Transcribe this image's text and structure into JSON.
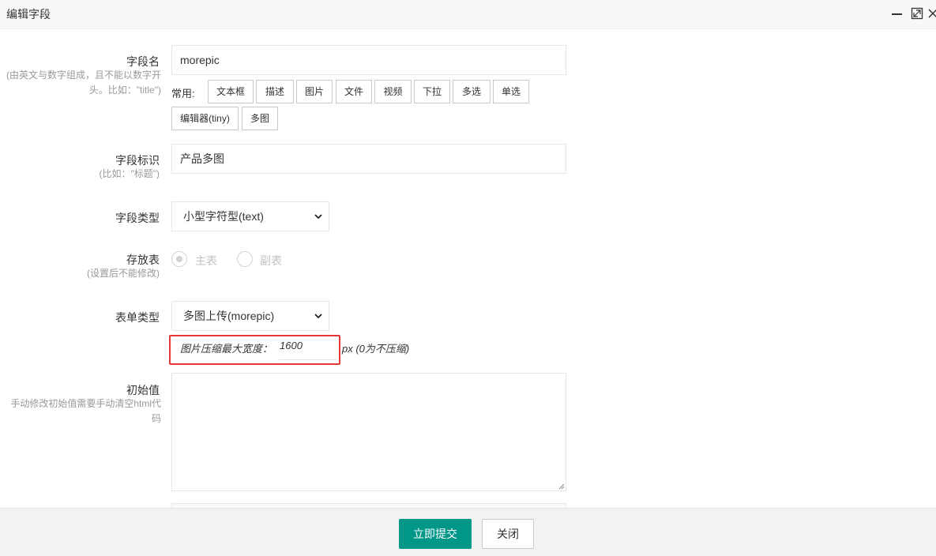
{
  "window": {
    "title": "编辑字段"
  },
  "field_name": {
    "label": "字段名",
    "hint": "(由英文与数字组成，且不能以数字开头。比如：\"title\")",
    "value": "morepic",
    "common_label": "常用:",
    "common_buttons": [
      "文本框",
      "描述",
      "图片",
      "文件",
      "视频",
      "下拉",
      "多选",
      "单选",
      "编辑器(tiny)",
      "多图"
    ]
  },
  "field_title": {
    "label": "字段标识",
    "hint": "(比如：\"标题\")",
    "value": "产品多图"
  },
  "field_type": {
    "label": "字段类型",
    "selected": "小型字符型(text)"
  },
  "storage": {
    "label": "存放表",
    "hint": "(设置后不能修改)",
    "options": [
      "主表",
      "副表"
    ],
    "selected": "主表"
  },
  "form_type": {
    "label": "表单类型",
    "selected": "多图上传(morepic)",
    "compress_label": "图片压缩最大宽度：",
    "compress_value": "1600",
    "compress_unit": "px (0为不压缩)"
  },
  "default_value": {
    "label": "初始值",
    "hint": "手动修改初始值需要手动清空html代码",
    "value": ""
  },
  "footer": {
    "submit": "立即提交",
    "close": "关闭"
  },
  "colors": {
    "primary": "#009688",
    "highlight_border": "#e53935"
  }
}
